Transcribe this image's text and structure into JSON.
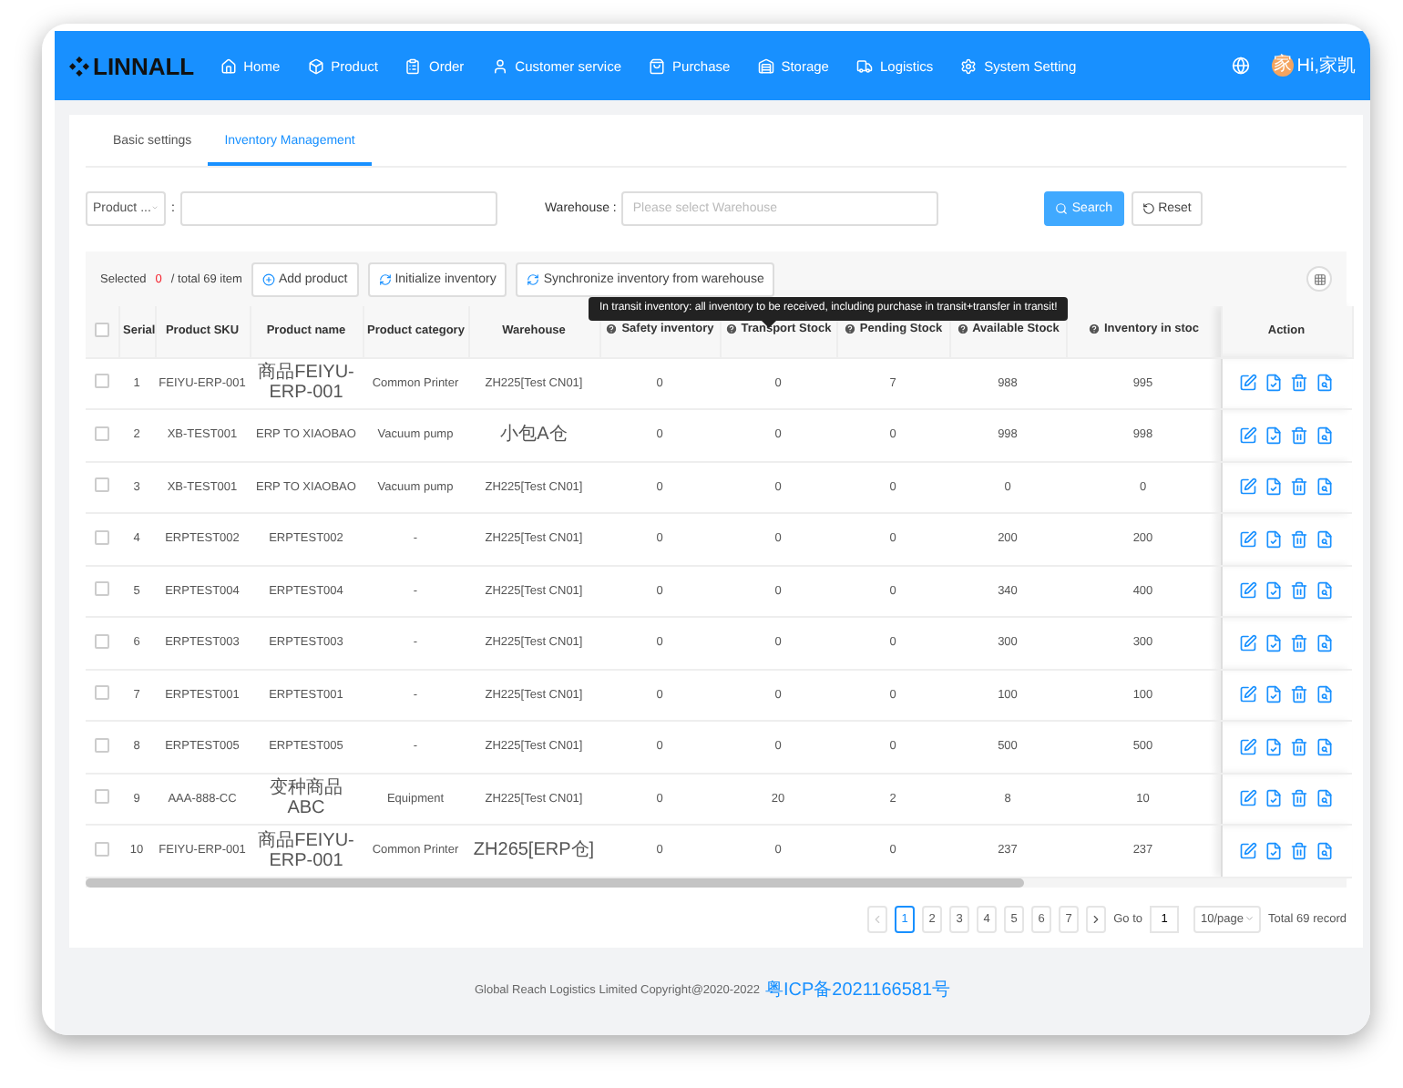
{
  "brand": "LINNALL",
  "nav": [
    {
      "label": "Home"
    },
    {
      "label": "Product"
    },
    {
      "label": "Order"
    },
    {
      "label": "Customer service"
    },
    {
      "label": "Purchase"
    },
    {
      "label": "Storage"
    },
    {
      "label": "Logistics"
    },
    {
      "label": "System Setting"
    }
  ],
  "user": {
    "avatar": "家",
    "name": "Hi,家凯"
  },
  "tabs": [
    {
      "label": "Basic settings",
      "selected": false
    },
    {
      "label": "Inventory Management",
      "selected": true
    }
  ],
  "filters": {
    "field_select": "Product ...",
    "separator": ":",
    "warehouse_label": "Warehouse :",
    "warehouse_placeholder": "Please select Warehouse"
  },
  "buttons": {
    "search": "Search",
    "reset": "Reset"
  },
  "toolbar": {
    "selected_label": "Selected",
    "selected_count": "0",
    "total": "/ total 69 item",
    "actions": [
      "Add product",
      "Initialize inventory",
      "Synchronize inventory from warehouse"
    ]
  },
  "tooltip": "In transit inventory: all inventory to be received, including purchase in transit+transfer in transit!",
  "table": {
    "all_checked": false,
    "columns": [
      {
        "label": "Serial",
        "help": false
      },
      {
        "label": "Product SKU",
        "help": false
      },
      {
        "label": "Product name",
        "help": false
      },
      {
        "label": "Product category",
        "help": false
      },
      {
        "label": "Warehouse",
        "help": false
      },
      {
        "label": "Safety inventory",
        "help": true
      },
      {
        "label": "Transport Stock",
        "help": true
      },
      {
        "label": "Pending Stock",
        "help": true
      },
      {
        "label": "Available Stock",
        "help": true
      },
      {
        "label": "Inventory in stoc",
        "help": true
      },
      {
        "label": "Action",
        "help": false
      }
    ],
    "rows": [
      {
        "checked": false,
        "cells": [
          "1",
          "FEIYU-ERP-001",
          "商品FEIYU-ERP-001",
          "Common Printer",
          "ZH225[Test CN01]",
          "0",
          "0",
          "7",
          "988",
          "995"
        ]
      },
      {
        "checked": false,
        "cells": [
          "2",
          "XB-TEST001",
          "ERP TO XIAOBAO",
          "Vacuum pump",
          "小包A仓",
          "0",
          "0",
          "0",
          "998",
          "998"
        ]
      },
      {
        "checked": false,
        "cells": [
          "3",
          "XB-TEST001",
          "ERP TO XIAOBAO",
          "Vacuum pump",
          "ZH225[Test CN01]",
          "0",
          "0",
          "0",
          "0",
          "0"
        ]
      },
      {
        "checked": false,
        "cells": [
          "4",
          "ERPTEST002",
          "ERPTEST002",
          "-",
          "ZH225[Test CN01]",
          "0",
          "0",
          "0",
          "200",
          "200"
        ]
      },
      {
        "checked": false,
        "cells": [
          "5",
          "ERPTEST004",
          "ERPTEST004",
          "-",
          "ZH225[Test CN01]",
          "0",
          "0",
          "0",
          "340",
          "400"
        ]
      },
      {
        "checked": false,
        "cells": [
          "6",
          "ERPTEST003",
          "ERPTEST003",
          "-",
          "ZH225[Test CN01]",
          "0",
          "0",
          "0",
          "300",
          "300"
        ]
      },
      {
        "checked": false,
        "cells": [
          "7",
          "ERPTEST001",
          "ERPTEST001",
          "-",
          "ZH225[Test CN01]",
          "0",
          "0",
          "0",
          "100",
          "100"
        ]
      },
      {
        "checked": false,
        "cells": [
          "8",
          "ERPTEST005",
          "ERPTEST005",
          "-",
          "ZH225[Test CN01]",
          "0",
          "0",
          "0",
          "500",
          "500"
        ]
      },
      {
        "checked": false,
        "cells": [
          "9",
          "AAA-888-CC",
          "变种商品ABC",
          "Equipment",
          "ZH225[Test CN01]",
          "0",
          "20",
          "2",
          "8",
          "10"
        ]
      },
      {
        "checked": false,
        "cells": [
          "10",
          "FEIYU-ERP-001",
          "商品FEIYU-ERP-001",
          "Common Printer",
          "ZH265[ERP仓]",
          "0",
          "0",
          "0",
          "237",
          "237"
        ]
      }
    ]
  },
  "pagination": {
    "pages": [
      {
        "label": "1",
        "selected": true
      },
      {
        "label": "2",
        "selected": false
      },
      {
        "label": "3",
        "selected": false
      },
      {
        "label": "4",
        "selected": false
      },
      {
        "label": "5",
        "selected": false
      },
      {
        "label": "6",
        "selected": false
      },
      {
        "label": "7",
        "selected": false
      }
    ],
    "prev_disabled": true,
    "goto_label": "Go to",
    "goto_value": "1",
    "page_size": "10/page",
    "total": "Total 69 record"
  },
  "footer": {
    "text": "Global Reach Logistics Limited Copyright@2020-2022",
    "link": "粤ICP备2021166581号"
  }
}
